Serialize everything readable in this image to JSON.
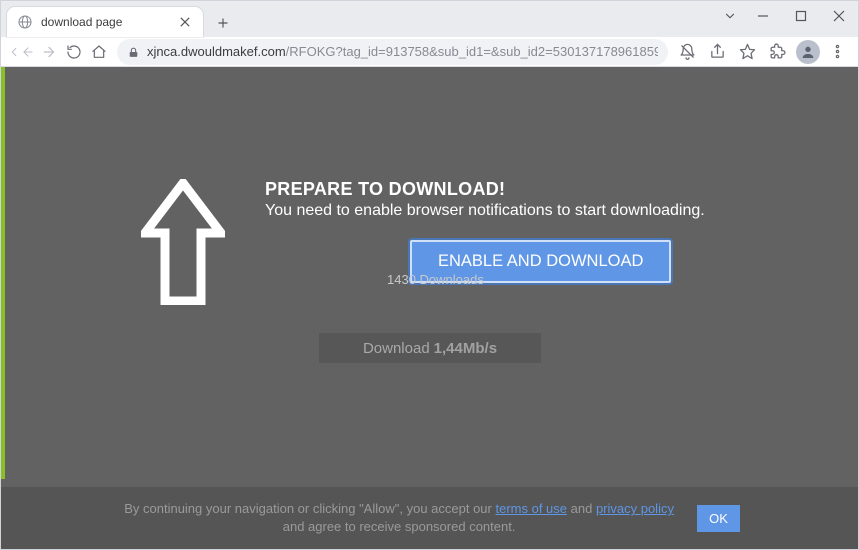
{
  "window": {
    "tab_title": "download page",
    "url_host": "xjnca.dwouldmakef.com",
    "url_path": "/RFOKG?tag_id=913758&sub_id1=&sub_id2=5301371789618599017&cookie_id..."
  },
  "page": {
    "headline": "PREPARE TO DOWNLOAD!",
    "subline": "You need to enable browser notifications to start downloading.",
    "enable_button": "ENABLE AND DOWNLOAD",
    "downloads_count": "1430 Downloads",
    "speed_label": "Download",
    "speed_value": "1,44Mb/s"
  },
  "consent": {
    "part1": "By continuing your navigation or clicking \"Allow\", you accept our ",
    "terms_link": "terms of use",
    "part2": " and ",
    "privacy_link": "privacy policy",
    "part3": " and agree to receive sponsored content.",
    "ok": "OK"
  }
}
